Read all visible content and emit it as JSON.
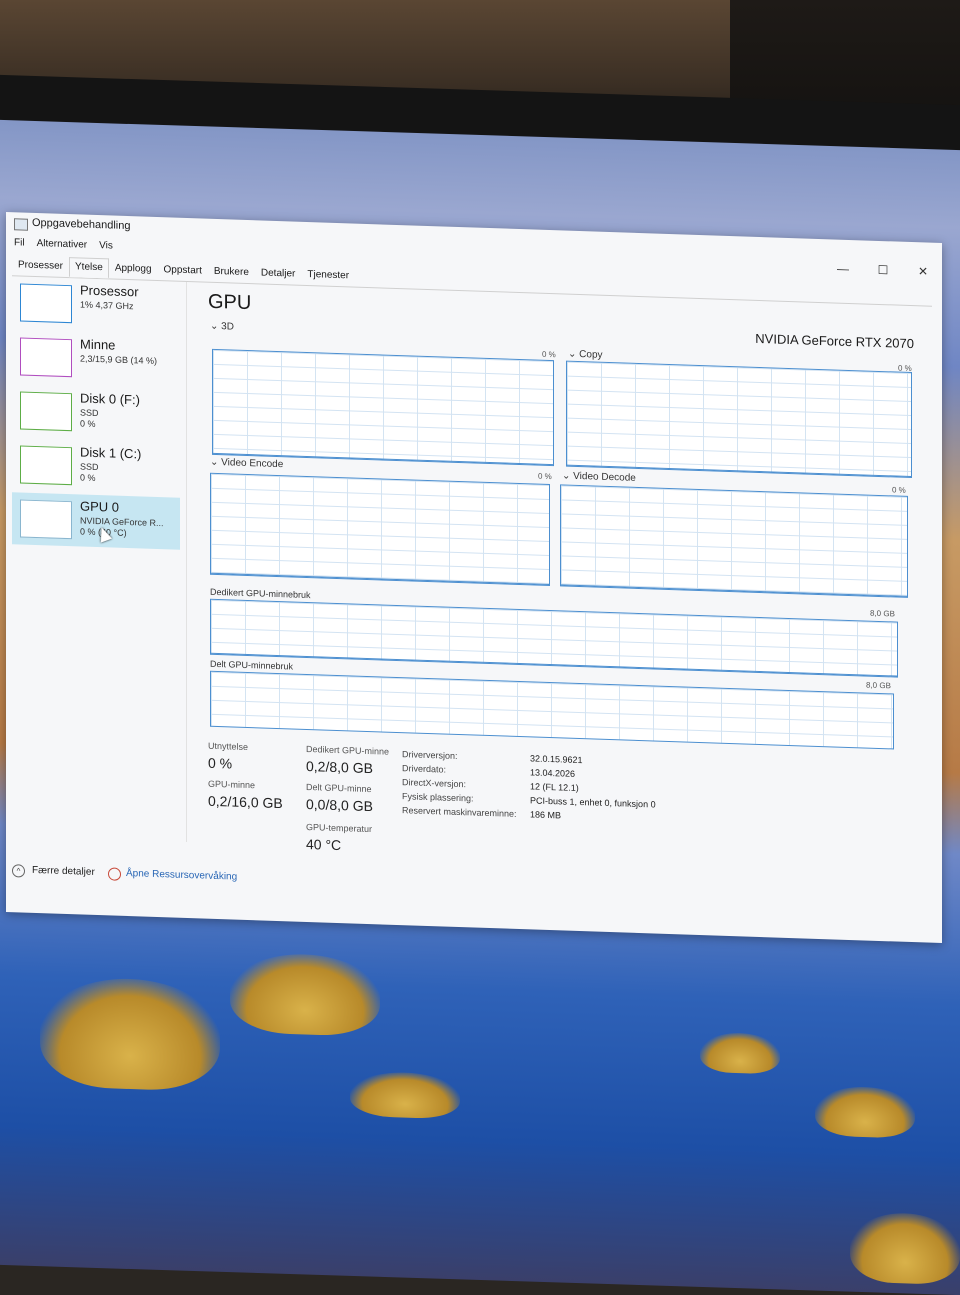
{
  "window": {
    "title": "Oppgavebehandling",
    "controls": {
      "minimize": "—",
      "maximize": "☐",
      "close": "✕"
    }
  },
  "menu": [
    "Fil",
    "Alternativer",
    "Vis"
  ],
  "tabs": [
    "Prosesser",
    "Ytelse",
    "Applogg",
    "Oppstart",
    "Brukere",
    "Detaljer",
    "Tjenester"
  ],
  "active_tab": "Ytelse",
  "sidebar": {
    "items": [
      {
        "name": "Prosessor",
        "line1": "1% 4,37 GHz",
        "line2": ""
      },
      {
        "name": "Minne",
        "line1": "2,3/15,9 GB (14 %)",
        "line2": ""
      },
      {
        "name": "Disk 0 (F:)",
        "line1": "SSD",
        "line2": "0 %"
      },
      {
        "name": "Disk 1 (C:)",
        "line1": "SSD",
        "line2": "0 %"
      },
      {
        "name": "GPU 0",
        "line1": "NVIDIA GeForce R...",
        "line2": "0 % (40 °C)"
      }
    ],
    "selected": "GPU 0"
  },
  "main": {
    "title": "GPU",
    "model": "NVIDIA GeForce RTX 2070",
    "graphs": {
      "g3d": {
        "label": "3D",
        "pct": "0 %"
      },
      "copy": {
        "label": "Copy",
        "pct": "0 %"
      },
      "video_encode": {
        "label": "Video Encode",
        "pct": "0 %"
      },
      "video_decode": {
        "label": "Video Decode",
        "pct": "0 %"
      },
      "dedicated_mem": {
        "label": "Dedikert GPU-minnebruk",
        "max": "8,0 GB"
      },
      "shared_mem": {
        "label": "Delt GPU-minnebruk",
        "max": "8,0 GB"
      }
    },
    "stats": {
      "utilization": {
        "label": "Utnyttelse",
        "value": "0 %"
      },
      "gpu_memory": {
        "label": "GPU-minne",
        "value": "0,2/16,0 GB"
      },
      "dedicated": {
        "label": "Dedikert GPU-minne",
        "value": "0,2/8,0 GB"
      },
      "shared": {
        "label": "Delt GPU-minne",
        "value": "0,0/8,0 GB"
      },
      "temperature": {
        "label": "GPU-temperatur",
        "value": "40 °C"
      }
    },
    "info": [
      {
        "key": "Driverversjon:",
        "value": "32.0.15.9621"
      },
      {
        "key": "Driverdato:",
        "value": "13.04.2026"
      },
      {
        "key": "DirectX-versjon:",
        "value": "12 (FL 12.1)"
      },
      {
        "key": "Fysisk plassering:",
        "value": "PCI-buss 1, enhet 0, funksjon 0"
      },
      {
        "key": "Reservert maskinvareminne:",
        "value": "186 MB"
      }
    ]
  },
  "footer": {
    "fewer_details": "Færre detaljer",
    "resource_monitor": "Åpne Ressursovervåking"
  },
  "colors": {
    "accent": "#4c8fd0",
    "selected_bg": "#c6e6f2",
    "cpu": "#2d86d3",
    "memory": "#b04dbf",
    "disk": "#5dad46"
  }
}
